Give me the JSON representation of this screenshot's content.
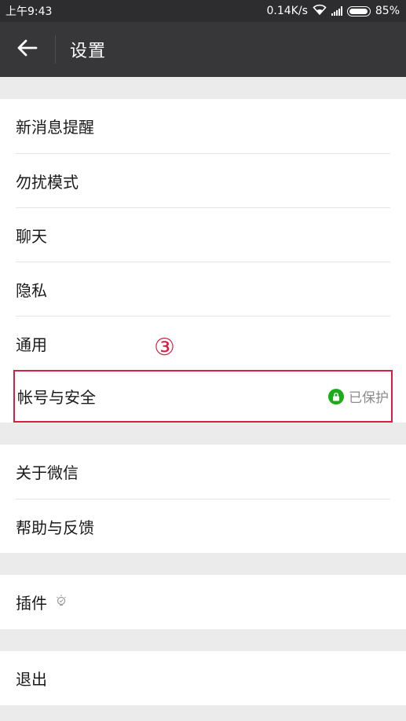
{
  "status_bar": {
    "time": "上午9:43",
    "net_speed": "0.14K/s",
    "battery": "85%"
  },
  "header": {
    "title": "设置",
    "back_icon": "arrow-left-icon"
  },
  "groups": [
    {
      "items": [
        {
          "label": "新消息提醒"
        },
        {
          "label": "勿扰模式"
        },
        {
          "label": "聊天"
        },
        {
          "label": "隐私"
        },
        {
          "label": "通用"
        },
        {
          "label": "帐号与安全",
          "status": "已保护"
        }
      ]
    },
    {
      "items": [
        {
          "label": "关于微信"
        },
        {
          "label": "帮助与反馈"
        }
      ]
    },
    {
      "items": [
        {
          "label": "插件"
        }
      ]
    },
    {
      "items": [
        {
          "label": "退出"
        }
      ]
    }
  ],
  "annotation": {
    "marker": "③",
    "color": "#d51f43"
  },
  "colors": {
    "status_bar_bg": "#2d2d2f",
    "app_bar_bg": "#37373a",
    "page_bg": "#ebebeb",
    "protected_green": "#1aad19"
  }
}
